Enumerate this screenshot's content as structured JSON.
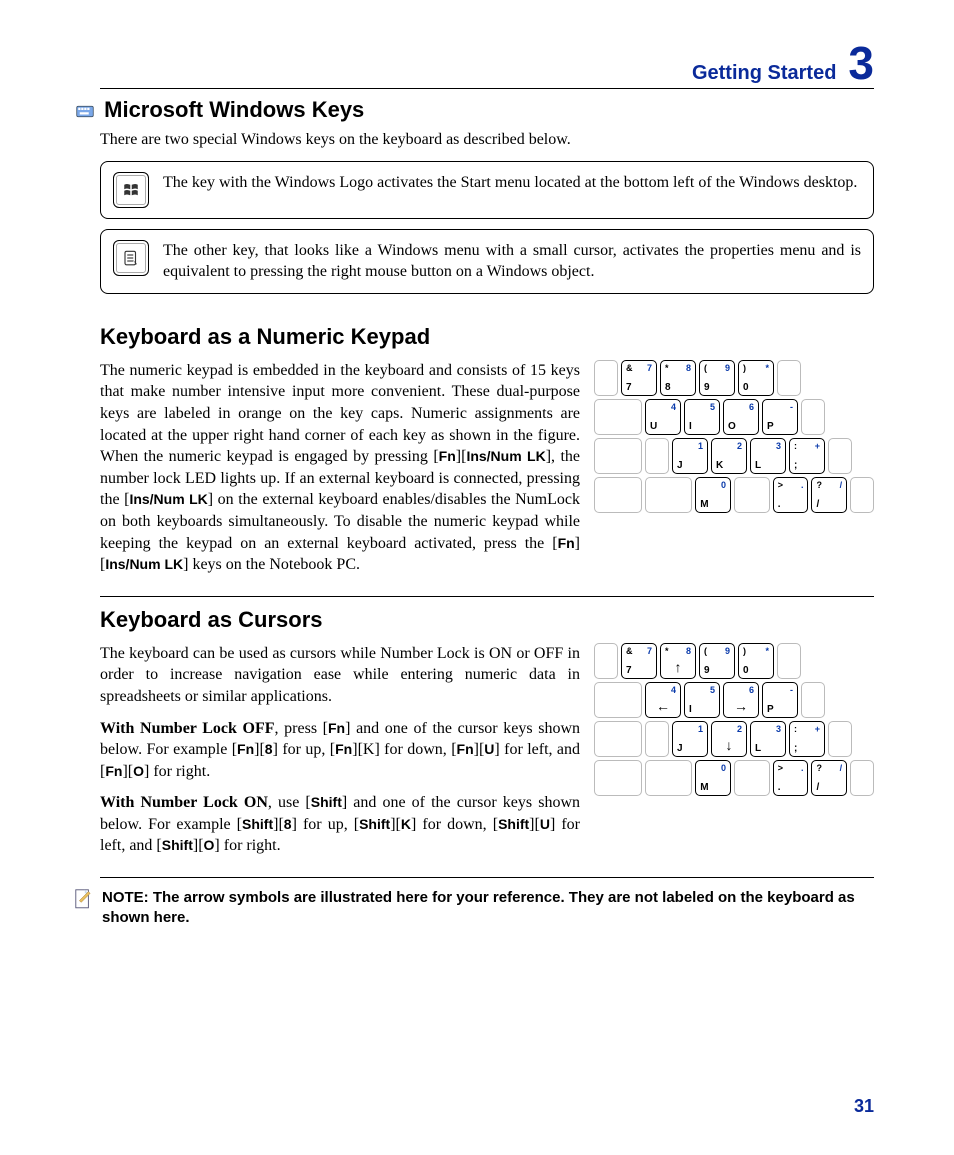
{
  "header": {
    "title": "Getting Started",
    "chapter": "3"
  },
  "page_number": "31",
  "section1": {
    "title": "Microsoft Windows Keys",
    "intro": "There are two special Windows keys on the keyboard as described below.",
    "block1": "The key with the Windows Logo activates the Start menu located at the bottom left of the Windows desktop.",
    "block2": "The other key, that looks like a Windows menu with a small cursor, activates the properties menu and is equivalent to pressing the right mouse button on a Windows object."
  },
  "section2": {
    "title": "Keyboard as a Numeric Keypad",
    "para_html": "The numeric keypad is embedded in the keyboard and consists of 15 keys that make number intensive input more convenient. These dual-purpose keys are labeled in orange on the key caps. Numeric assignments are located at the upper right hand corner of each key as shown in the figure. When the numeric keypad is engaged by pressing [<b class='fn'>Fn</b>][<b class='fn'>Ins/Num LK</b>], the number lock LED lights up. If an external keyboard is connected, pressing the [<b class='fn'>Ins/Num LK</b>] on the external keyboard enables/disables the NumLock on both keyboards simultaneously. To disable the numeric keypad while keeping the keypad on an external keyboard activated, press the  [<b class='fn'>Fn</b>][<b class='fn'>Ins/Num LK</b>] keys on the Notebook PC.",
    "keypad": {
      "rows": [
        [
          {
            "blank": true,
            "w": "s"
          },
          {
            "top": "&",
            "main": "7",
            "num": "7"
          },
          {
            "top": "*",
            "main": "8",
            "num": "8"
          },
          {
            "top": "(",
            "main": "9",
            "num": "9"
          },
          {
            "top": ")",
            "main": "0",
            "num": "*"
          },
          {
            "blank": true,
            "w": "s"
          }
        ],
        [
          {
            "blank": true,
            "w": "m"
          },
          {
            "main": "U",
            "num": "4"
          },
          {
            "main": "I",
            "num": "5"
          },
          {
            "main": "O",
            "num": "6"
          },
          {
            "main": "P",
            "num": "-"
          },
          {
            "blank": true,
            "w": "s"
          }
        ],
        [
          {
            "blank": true,
            "w": "m"
          },
          {
            "blank": true,
            "w": "s"
          },
          {
            "main": "J",
            "num": "1"
          },
          {
            "main": "K",
            "num": "2"
          },
          {
            "main": "L",
            "num": "3"
          },
          {
            "top": ":",
            "main": ";",
            "num": "+"
          },
          {
            "blank": true,
            "w": "s"
          }
        ],
        [
          {
            "blank": true,
            "w": "m"
          },
          {
            "blank": true,
            "w": "m"
          },
          {
            "main": "M",
            "num": "0"
          },
          {
            "blank": true
          },
          {
            "top": ">",
            "main": ".",
            "num": "."
          },
          {
            "top": "?",
            "main": "/",
            "num": "/"
          },
          {
            "blank": true,
            "w": "s"
          }
        ]
      ]
    }
  },
  "section3": {
    "title": "Keyboard as Cursors",
    "para1": "The keyboard can be used as cursors while Number Lock is ON or OFF in order to increase navigation ease while entering numeric data in spreadsheets or similar applications.",
    "para2_html": "<b>With Number Lock OFF</b>, press [<b class='fn'>Fn</b>] and one of the cursor keys shown below. For example [<b class='fn'>Fn</b>][<b class='fn'>8</b>] for up, [<b class='fn'>Fn</b>][K] for down, [<b class='fn'>Fn</b>][<b class='fn'>U</b>] for left, and [<b class='fn'>Fn</b>][<b class='fn'>O</b>] for right.",
    "para3_html": "<b>With Number Lock ON</b>, use [<b class='fn'>Shift</b>] and one of the cursor keys shown below. For example [<b class='fn'>Shift</b>][<b class='fn'>8</b>] for up, [<b class='fn'>Shift</b>][<b class='fn'>K</b>] for down, [<b class='fn'>Shift</b>][<b class='fn'>U</b>] for left, and [<b class='fn'>Shift</b>][<b class='fn'>O</b>] for right.",
    "keypad": {
      "rows": [
        [
          {
            "blank": true,
            "w": "s"
          },
          {
            "top": "&",
            "main": "7",
            "num": "7"
          },
          {
            "top": "*",
            "main": "8",
            "num": "8",
            "arrow": "↑"
          },
          {
            "top": "(",
            "main": "9",
            "num": "9"
          },
          {
            "top": ")",
            "main": "0",
            "num": "*"
          },
          {
            "blank": true,
            "w": "s"
          }
        ],
        [
          {
            "blank": true,
            "w": "m"
          },
          {
            "main": "U",
            "num": "4",
            "arrow": "←"
          },
          {
            "main": "I",
            "num": "5"
          },
          {
            "main": "O",
            "num": "6",
            "arrow": "→"
          },
          {
            "main": "P",
            "num": "-"
          },
          {
            "blank": true,
            "w": "s"
          }
        ],
        [
          {
            "blank": true,
            "w": "m"
          },
          {
            "blank": true,
            "w": "s"
          },
          {
            "main": "J",
            "num": "1"
          },
          {
            "main": "K",
            "num": "2",
            "arrow": "↓"
          },
          {
            "main": "L",
            "num": "3"
          },
          {
            "top": ":",
            "main": ";",
            "num": "+"
          },
          {
            "blank": true,
            "w": "s"
          }
        ],
        [
          {
            "blank": true,
            "w": "m"
          },
          {
            "blank": true,
            "w": "m"
          },
          {
            "main": "M",
            "num": "0"
          },
          {
            "blank": true
          },
          {
            "top": ">",
            "main": ".",
            "num": "."
          },
          {
            "top": "?",
            "main": "/",
            "num": "/"
          },
          {
            "blank": true,
            "w": "s"
          }
        ]
      ]
    }
  },
  "note": "NOTE: The arrow symbols are illustrated here for your reference. They are not labeled on the keyboard as shown here."
}
